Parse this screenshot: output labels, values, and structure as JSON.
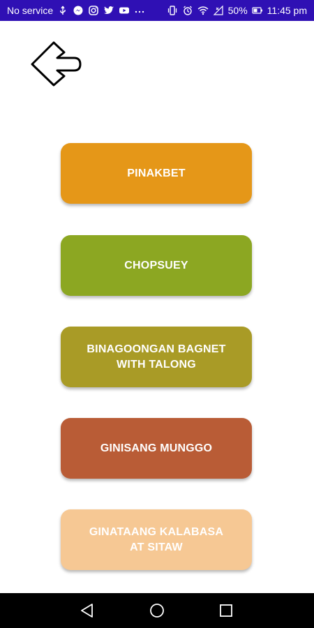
{
  "status_bar": {
    "carrier": "No service",
    "battery": "50%",
    "time": "11:45 pm",
    "notification_icons": [
      "usb-icon",
      "messenger-icon",
      "instagram-icon",
      "twitter-icon",
      "youtube-icon",
      "more-icon"
    ],
    "system_icons": [
      "vibrate-icon",
      "alarm-icon",
      "wifi-icon",
      "signal-icon",
      "battery-icon"
    ]
  },
  "back_button": {
    "icon": "back-arrow-icon"
  },
  "menu": {
    "items": [
      {
        "label": "PINAKBET",
        "color": "#e59718"
      },
      {
        "label": "CHOPSUEY",
        "color": "#8ca722"
      },
      {
        "label": "BINAGOONGAN BAGNET WITH TALONG",
        "color": "#a99b26"
      },
      {
        "label": "GINISANG MUNGGO",
        "color": "#b95c36"
      },
      {
        "label": "GINATAANG KALABASA AT SITAW",
        "color": "#f6c894"
      }
    ]
  },
  "nav_bar": {
    "items": [
      "back-triangle-icon",
      "home-circle-icon",
      "recents-square-icon"
    ]
  }
}
